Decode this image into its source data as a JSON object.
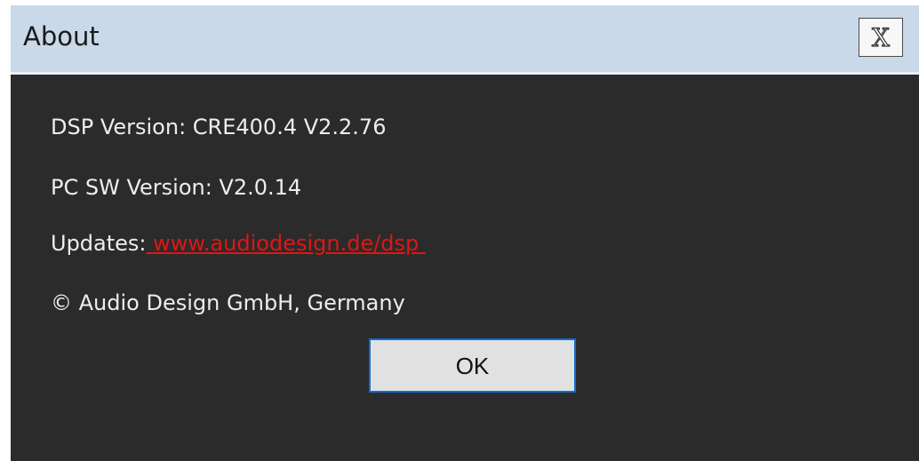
{
  "window": {
    "title": "About",
    "close_label": "X"
  },
  "info": {
    "dsp_version": "DSP Version: CRE400.4 V2.2.76",
    "pc_sw_version": "PC SW Version: V2.0.14",
    "updates_label": "Updates:",
    "updates_link": " www.audiodesign.de/dsp ",
    "copyright": "© Audio Design GmbH, Germany"
  },
  "buttons": {
    "ok_label": "OK"
  },
  "colors": {
    "titlebar": "#c9d9ea",
    "background": "#2b2b2b",
    "link": "#e01515",
    "focus": "#0f6fd0"
  }
}
